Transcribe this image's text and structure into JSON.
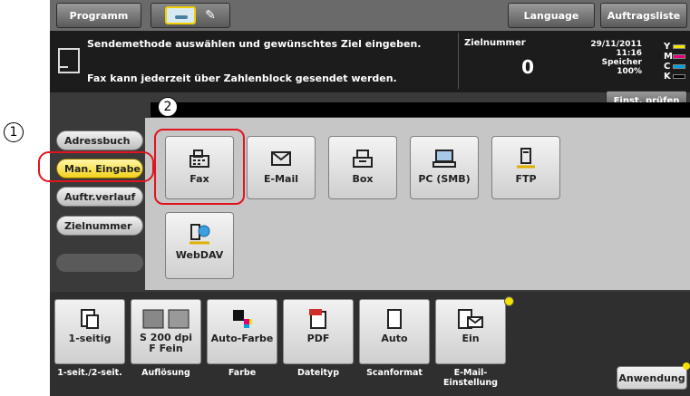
{
  "topbar": {
    "program_label": "Programm",
    "language_label": "Language",
    "jobs_label": "Auftragsliste"
  },
  "message": {
    "line1": "Sendemethode auswählen und gewünschtes Ziel eingeben.",
    "line2": "Fax kann jederzeit über Zahlenblock gesendet werden.",
    "dest_number_label": "Zielnummer",
    "dest_number_value": "0"
  },
  "status": {
    "date": "29/11/2011",
    "time": "11:16",
    "memory_label": "Speicher",
    "memory_value": "100%",
    "toner_letters": [
      "Y",
      "M",
      "C",
      "K"
    ],
    "toner_colors": [
      "#f2e600",
      "#e2007a",
      "#00a0e0",
      "#000000"
    ],
    "check_settings_label": "Einst. prüfen"
  },
  "annotations": {
    "marker1": "1",
    "marker2": "2",
    "highlight_color": "#e0141e"
  },
  "sidebar": {
    "items": [
      {
        "label": "Adressbuch"
      },
      {
        "label": "Man. Eingabe"
      },
      {
        "label": "Auftr.verlauf"
      },
      {
        "label": "Zielnummer"
      }
    ]
  },
  "destinations": [
    {
      "label": "Fax",
      "icon": "fax-icon"
    },
    {
      "label": "E-Mail",
      "icon": "envelope-icon"
    },
    {
      "label": "Box",
      "icon": "box-icon"
    },
    {
      "label": "PC (SMB)",
      "icon": "computer-icon"
    },
    {
      "label": "FTP",
      "icon": "server-icon"
    },
    {
      "label": "WebDAV",
      "icon": "webdav-icon"
    }
  ],
  "settings": [
    {
      "value": "1-seitig",
      "caption": "1-seit./2-seit.",
      "icon": "one-sided-icon"
    },
    {
      "value": "S 200 dpi\nF Fein",
      "caption": "Auflösung",
      "icon": "resolution-icon"
    },
    {
      "value": "Auto-Farbe",
      "caption": "Farbe",
      "icon": "color-icon"
    },
    {
      "value": "PDF",
      "caption": "Dateityp",
      "icon": "pdf-icon"
    },
    {
      "value": "Auto",
      "caption": "Scanformat",
      "icon": "page-icon"
    },
    {
      "value": "Ein",
      "caption": "E-Mail-\nEinstellung",
      "icon": "email-settings-icon"
    }
  ],
  "application_label": "Anwendung"
}
